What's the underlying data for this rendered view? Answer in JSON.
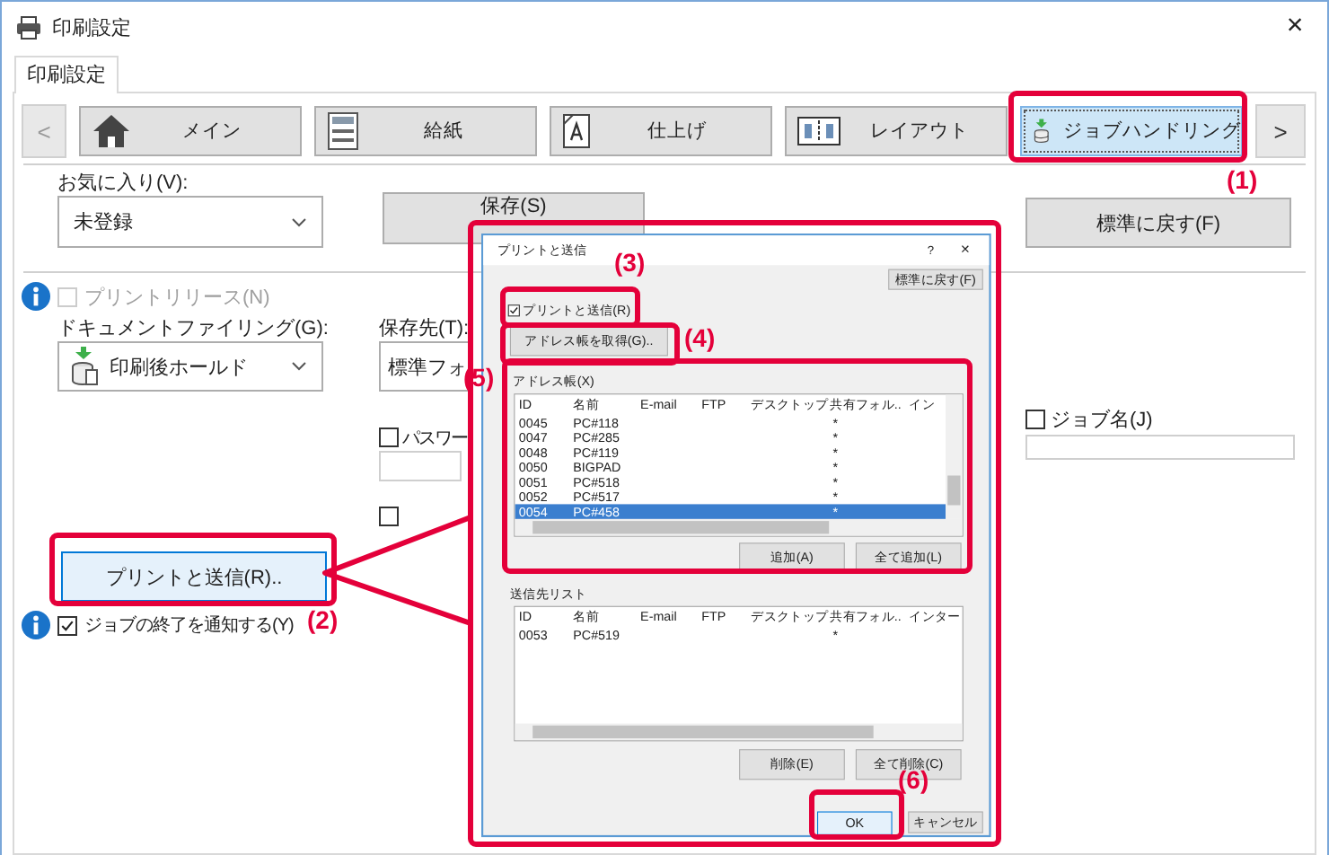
{
  "window": {
    "title": "印刷設定",
    "close": "×"
  },
  "tabs": [
    {
      "label": "印刷設定",
      "selected": true
    }
  ],
  "nav": {
    "prev": "<",
    "next": ">",
    "tabs": [
      {
        "label": "メイン",
        "kind": "home",
        "selected": false
      },
      {
        "label": "給紙",
        "kind": "paper",
        "selected": false
      },
      {
        "label": "仕上げ",
        "kind": "finishing",
        "selected": false
      },
      {
        "label": "レイアウト",
        "kind": "layout",
        "selected": false
      },
      {
        "label": "ジョブハンドリング",
        "kind": "job",
        "selected": true
      }
    ]
  },
  "favorites": {
    "label": "お気に入り(V):",
    "value": "未登録"
  },
  "save_button": "保存(S)",
  "reset_button": "標準に戻す(F)",
  "print_release": {
    "label": "プリントリリース(N)",
    "checked": false,
    "disabled": true
  },
  "document_filing": {
    "label": "ドキュメントファイリング(G):",
    "value": "印刷後ホールド"
  },
  "storage": {
    "label": "保存先(T):",
    "value": "標準フォ"
  },
  "password": {
    "label": "パスワー",
    "checked": false
  },
  "extra_checkbox": {
    "checked": false
  },
  "print_and_send_button": "プリントと送信(R)..",
  "job_end_notice": {
    "label": "ジョブの終了を通知する(Y)",
    "checked": true
  },
  "job_name": {
    "label": "ジョブ名(J)",
    "checked": false
  },
  "dialog": {
    "title": "プリントと送信",
    "help": "?",
    "close": "×",
    "reset": "標準に戻す(F)",
    "print_and_send": {
      "label": "プリントと送信(R)",
      "checked": true
    },
    "get_address_book": "アドレス帳を取得(G)..",
    "address_book": {
      "label": "アドレス帳(X)",
      "columns": [
        "ID",
        "名前",
        "E-mail",
        "FTP",
        "デスクトップ",
        "共有フォル..",
        "イン"
      ],
      "rows": [
        {
          "id": "0045",
          "name": "PC#118",
          "shared_folder": "*",
          "selected": false
        },
        {
          "id": "0047",
          "name": "PC#285",
          "shared_folder": "*",
          "selected": false
        },
        {
          "id": "0048",
          "name": "PC#119",
          "shared_folder": "*",
          "selected": false
        },
        {
          "id": "0050",
          "name": "BIGPAD",
          "shared_folder": "*",
          "selected": false
        },
        {
          "id": "0051",
          "name": "PC#518",
          "shared_folder": "*",
          "selected": false
        },
        {
          "id": "0052",
          "name": "PC#517",
          "shared_folder": "*",
          "selected": false
        },
        {
          "id": "0054",
          "name": "PC#458",
          "shared_folder": "*",
          "selected": true
        }
      ],
      "add": "追加(A)",
      "add_all": "全て追加(L)"
    },
    "send_list": {
      "label": "送信先リスト",
      "columns": [
        "ID",
        "名前",
        "E-mail",
        "FTP",
        "デスクトップ",
        "共有フォル..",
        "インター"
      ],
      "rows": [
        {
          "id": "0053",
          "name": "PC#519",
          "shared_folder": "*",
          "selected": false
        }
      ],
      "remove": "削除(E)",
      "remove_all": "全て削除(C)"
    },
    "ok": "OK",
    "cancel": "キャンセル"
  },
  "callouts": [
    "(1)",
    "(2)",
    "(3)",
    "(4)",
    "(5)",
    "(6)"
  ]
}
